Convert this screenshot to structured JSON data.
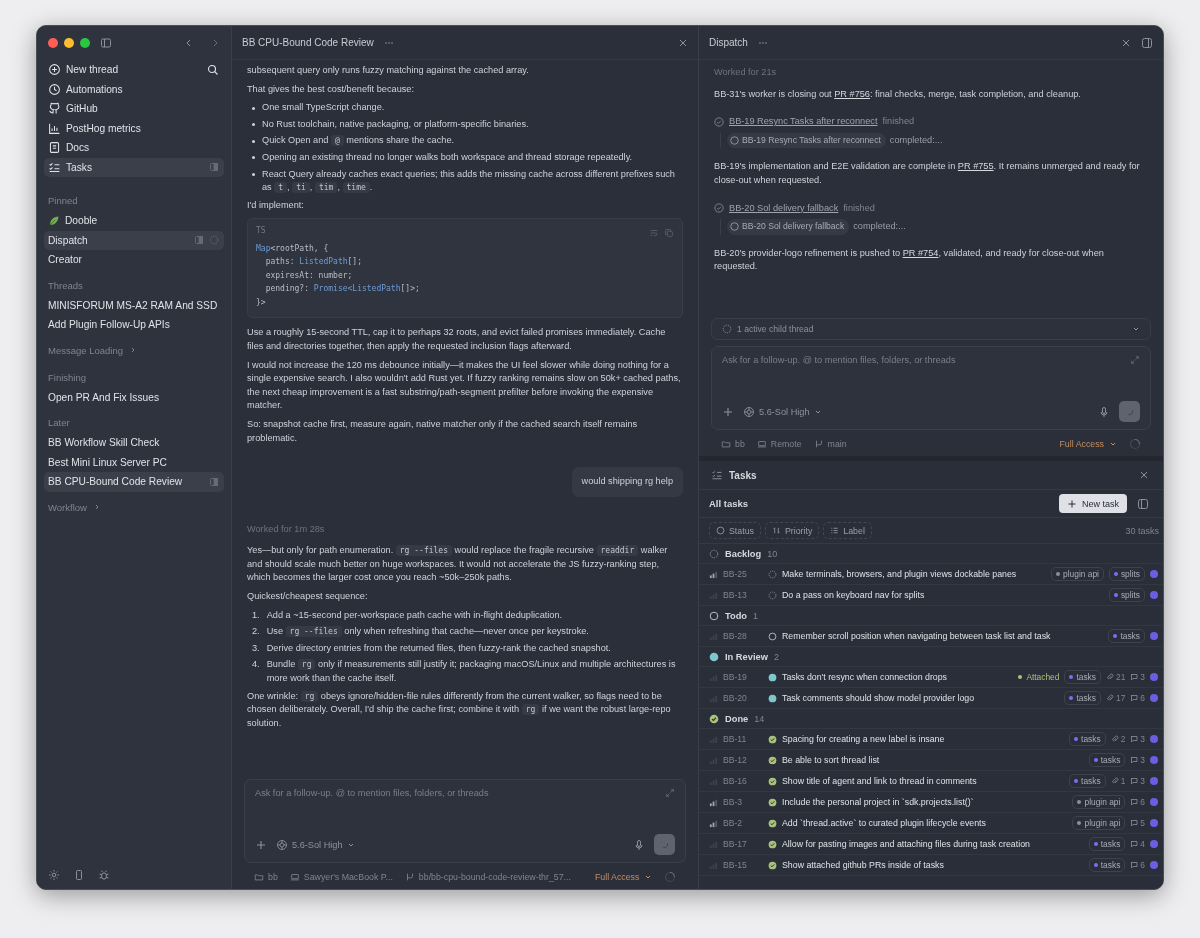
{
  "sidebar": {
    "nav": [
      {
        "label": "New thread",
        "selected": false
      },
      {
        "label": "Automations",
        "selected": false
      },
      {
        "label": "GitHub",
        "selected": false
      },
      {
        "label": "PostHog metrics",
        "selected": false
      },
      {
        "label": "Docs",
        "selected": false
      },
      {
        "label": "Tasks",
        "selected": true
      }
    ],
    "sections": [
      {
        "kind": "group",
        "title": "Pinned",
        "items": [
          {
            "kind": "project",
            "label": "Dooble",
            "selected": false,
            "running": false
          },
          {
            "kind": "thread",
            "label": "Dispatch",
            "selected": true,
            "running": true
          },
          {
            "kind": "thread",
            "label": "Creator",
            "selected": false,
            "running": false
          }
        ]
      },
      {
        "kind": "group",
        "title": "Threads",
        "items": [
          {
            "kind": "thread",
            "label": "MINISFORUM MS-A2 RAM And SSD",
            "selected": false,
            "running": false
          },
          {
            "kind": "thread",
            "label": "Add Plugin Follow-Up APIs",
            "selected": false,
            "running": false
          }
        ]
      },
      {
        "kind": "folder",
        "title": "Message Loading",
        "expanded": false
      },
      {
        "kind": "group",
        "title": "Finishing",
        "items": [
          {
            "kind": "thread",
            "label": "Open PR And Fix Issues",
            "selected": false,
            "running": false
          }
        ]
      },
      {
        "kind": "group",
        "title": "Later",
        "items": [
          {
            "kind": "thread",
            "label": "BB Workflow Skill Check",
            "selected": false,
            "running": false
          },
          {
            "kind": "thread",
            "label": "Best Mini Linux Server PC",
            "selected": false,
            "running": false
          },
          {
            "kind": "thread",
            "label": "BB CPU-Bound Code Review",
            "selected": true,
            "running": false
          }
        ]
      },
      {
        "kind": "folder",
        "title": "Workflow",
        "expanded": false
      }
    ]
  },
  "thread": {
    "title": "BB CPU-Bound Code Review",
    "blocks": [
      {
        "kind": "para",
        "parts": [
          {
            "kind": "text",
            "text": "subsequent query only runs fuzzy matching against the cached array."
          }
        ]
      },
      {
        "kind": "para",
        "parts": [
          {
            "kind": "text",
            "text": "That gives the best cost/benefit because:"
          }
        ]
      },
      {
        "kind": "bullets",
        "items": [
          [
            {
              "kind": "text",
              "text": "One small TypeScript change."
            }
          ],
          [
            {
              "kind": "text",
              "text": "No Rust toolchain, native packaging, or platform-specific binaries."
            }
          ],
          [
            {
              "kind": "text",
              "text": "Quick Open and "
            },
            {
              "kind": "code",
              "text": "@"
            },
            {
              "kind": "text",
              "text": " mentions share the cache."
            }
          ],
          [
            {
              "kind": "text",
              "text": "Opening an existing thread no longer walks both workspace and thread storage repeatedly."
            }
          ],
          [
            {
              "kind": "text",
              "text": "React Query already caches exact queries; this adds the missing cache across different prefixes such as "
            },
            {
              "kind": "code",
              "text": "t"
            },
            {
              "kind": "text",
              "text": ", "
            },
            {
              "kind": "code",
              "text": "ti"
            },
            {
              "kind": "text",
              "text": ", "
            },
            {
              "kind": "code",
              "text": "tim"
            },
            {
              "kind": "text",
              "text": ", "
            },
            {
              "kind": "code",
              "text": "time"
            },
            {
              "kind": "text",
              "text": "."
            }
          ]
        ]
      },
      {
        "kind": "para",
        "parts": [
          {
            "kind": "text",
            "text": "I'd implement:"
          }
        ]
      },
      {
        "kind": "code",
        "lang": "TS",
        "lines": [
          [
            {
              "kind": "type",
              "text": "Map"
            },
            {
              "kind": "plain",
              "text": "<rootPath, {"
            }
          ],
          [
            {
              "kind": "plain",
              "text": "  paths: "
            },
            {
              "kind": "type",
              "text": "ListedPath"
            },
            {
              "kind": "plain",
              "text": "[];"
            }
          ],
          [
            {
              "kind": "plain",
              "text": "  expiresAt: number;"
            }
          ],
          [
            {
              "kind": "plain",
              "text": "  pending?: "
            },
            {
              "kind": "type",
              "text": "Promise<ListedPath"
            },
            {
              "kind": "plain",
              "text": "[]>;"
            }
          ],
          [
            {
              "kind": "plain",
              "text": "}>"
            }
          ]
        ]
      },
      {
        "kind": "para",
        "parts": [
          {
            "kind": "text",
            "text": "Use a roughly 15-second TTL, cap it to perhaps 32 roots, and evict failed promises immediately. Cache files and directories together, then apply the requested inclusion flags afterward."
          }
        ]
      },
      {
        "kind": "para",
        "parts": [
          {
            "kind": "text",
            "text": "I would not increase the 120 ms debounce initially—it makes the UI feel slower while doing nothing for a single expensive search. I also wouldn't add Rust yet. If fuzzy ranking remains slow on 50k+ cached paths, the next cheap improvement is a fast substring/path-segment prefilter before invoking the expensive matcher."
          }
        ]
      },
      {
        "kind": "para",
        "parts": [
          {
            "kind": "text",
            "text": "So: snapshot cache first, measure again, native matcher only if the cached search itself remains problematic."
          }
        ]
      },
      {
        "kind": "user",
        "text": "would shipping rg help"
      },
      {
        "kind": "status",
        "text": "Worked for 1m 28s"
      },
      {
        "kind": "para",
        "parts": [
          {
            "kind": "text",
            "text": "Yes—but only for path enumeration. "
          },
          {
            "kind": "code",
            "text": "rg --files"
          },
          {
            "kind": "text",
            "text": " would replace the fragile recursive "
          },
          {
            "kind": "code",
            "text": "readdir"
          },
          {
            "kind": "text",
            "text": " walker and should scale much better on huge workspaces. It would not accelerate the JS fuzzy-ranking step, which becomes the larger cost once you reach ~50k–250k paths."
          }
        ]
      },
      {
        "kind": "para",
        "parts": [
          {
            "kind": "text",
            "text": "Quickest/cheapest sequence:"
          }
        ]
      },
      {
        "kind": "numbered",
        "items": [
          {
            "number": "1.",
            "parts": [
              {
                "kind": "text",
                "text": "Add a ~15-second per-workspace path cache with in-flight deduplication."
              }
            ]
          },
          {
            "number": "2.",
            "parts": [
              {
                "kind": "text",
                "text": "Use "
              },
              {
                "kind": "code",
                "text": "rg --files"
              },
              {
                "kind": "text",
                "text": " only when refreshing that cache—never once per keystroke."
              }
            ]
          },
          {
            "number": "3.",
            "parts": [
              {
                "kind": "text",
                "text": "Derive directory entries from the returned files, then fuzzy-rank the cached snapshot."
              }
            ]
          },
          {
            "number": "4.",
            "parts": [
              {
                "kind": "text",
                "text": "Bundle "
              },
              {
                "kind": "code",
                "text": "rg"
              },
              {
                "kind": "text",
                "text": " only if measurements still justify it; packaging macOS/Linux and multiple architectures is more work than the cache itself."
              }
            ]
          }
        ]
      },
      {
        "kind": "para",
        "parts": [
          {
            "kind": "text",
            "text": "One wrinkle: "
          },
          {
            "kind": "code",
            "text": "rg"
          },
          {
            "kind": "text",
            "text": " obeys ignore/hidden-file rules differently from the current walker, so flags need to be chosen deliberately. Overall, I'd ship the cache first; combine it with "
          },
          {
            "kind": "code",
            "text": "rg"
          },
          {
            "kind": "text",
            "text": " if we want the robust large-repo solution."
          }
        ]
      }
    ],
    "composer": {
      "placeholder": "Ask for a follow-up. @ to mention files, folders, or threads",
      "model": "5.6-Sol High"
    },
    "footer": {
      "items": [
        "bb",
        "Sawyer's MacBook P...",
        "bb/bb-cpu-bound-code-review-thr_57..."
      ],
      "access": "Full Access"
    }
  },
  "dispatch": {
    "title": "Dispatch",
    "blocks": [
      {
        "kind": "status",
        "text": "Worked for 21s"
      },
      {
        "kind": "para",
        "parts": [
          {
            "kind": "text",
            "text": "BB-31's worker is closing out "
          },
          {
            "kind": "link",
            "text": "PR #756"
          },
          {
            "kind": "text",
            "text": ": final checks, merge, task completion, and cleanup."
          }
        ]
      },
      {
        "kind": "event",
        "link": "BB-19 Resync Tasks after reconnect",
        "suffix": "finished",
        "chip": "BB-19 Resync Tasks after reconnect",
        "detail": "completed:..."
      },
      {
        "kind": "para",
        "parts": [
          {
            "kind": "text",
            "text": "BB-19's implementation and E2E validation are complete in "
          },
          {
            "kind": "link",
            "text": "PR #755"
          },
          {
            "kind": "text",
            "text": ". It remains unmerged and ready for close-out when requested."
          }
        ]
      },
      {
        "kind": "event",
        "link": "BB-20 Sol delivery fallback",
        "suffix": "finished",
        "chip": "BB-20 Sol delivery fallback",
        "detail": "completed:..."
      },
      {
        "kind": "para",
        "parts": [
          {
            "kind": "text",
            "text": "BB-20's provider-logo refinement is pushed to "
          },
          {
            "kind": "link",
            "text": "PR #754"
          },
          {
            "kind": "text",
            "text": ", validated, and ready for close-out when requested."
          }
        ]
      }
    ],
    "child_threads": {
      "text": "1 active child thread",
      "expanded": false
    },
    "composer": {
      "placeholder": "Ask for a follow-up. @ to mention files, folders, or threads",
      "model": "5.6-Sol High"
    },
    "footer": {
      "items": [
        "bb",
        "Remote",
        "main"
      ],
      "access": "Full Access"
    }
  },
  "tasks": {
    "title": "Tasks",
    "view": "All tasks",
    "new_button": "New task",
    "filters": [
      "Status",
      "Priority",
      "Label"
    ],
    "count": "30 tasks",
    "groups": [
      {
        "kind": "backlog",
        "name": "Backlog",
        "count": "10",
        "tasks": [
          {
            "id": "BB-25",
            "prioritized": true,
            "title": "Make terminals, browsers, and plugin views dockable panes",
            "labels": [
              {
                "text": "plugin api",
                "color": "#8a8f9b"
              },
              {
                "text": "splits",
                "color": "#7a6ff0"
              }
            ]
          },
          {
            "id": "BB-13",
            "prioritized": false,
            "title": "Do a pass on keyboard nav for splits",
            "labels": [
              {
                "text": "splits",
                "color": "#7a6ff0"
              }
            ]
          }
        ]
      },
      {
        "kind": "todo",
        "name": "Todo",
        "count": "1",
        "tasks": [
          {
            "id": "BB-28",
            "prioritized": false,
            "title": "Remember scroll position when navigating between task list and task",
            "labels": [
              {
                "text": "tasks",
                "color": "#7a6ff0"
              }
            ]
          }
        ]
      },
      {
        "kind": "review",
        "name": "In Review",
        "count": "2",
        "tasks": [
          {
            "id": "BB-19",
            "prioritized": false,
            "title": "Tasks don't resync when connection drops",
            "badge": "Attached",
            "labels": [
              {
                "text": "tasks",
                "color": "#7a6ff0"
              }
            ],
            "attachments": "21",
            "comments": "3"
          },
          {
            "id": "BB-20",
            "prioritized": false,
            "title": "Task comments should show model provider logo",
            "labels": [
              {
                "text": "tasks",
                "color": "#7a6ff0"
              }
            ],
            "attachments": "17",
            "comments": "6"
          }
        ]
      },
      {
        "kind": "done",
        "name": "Done",
        "count": "14",
        "tasks": [
          {
            "id": "BB-11",
            "prioritized": false,
            "title": "Spacing for creating a new label is insane",
            "labels": [
              {
                "text": "tasks",
                "color": "#7a6ff0"
              }
            ],
            "attachments": "2",
            "comments": "3"
          },
          {
            "id": "BB-12",
            "prioritized": false,
            "title": "Be able to sort thread list",
            "labels": [
              {
                "text": "tasks",
                "color": "#7a6ff0"
              }
            ],
            "comments": "3"
          },
          {
            "id": "BB-16",
            "prioritized": false,
            "title": "Show title of agent and link to thread in comments",
            "labels": [
              {
                "text": "tasks",
                "color": "#7a6ff0"
              }
            ],
            "attachments": "1",
            "comments": "3"
          },
          {
            "id": "BB-3",
            "prioritized": true,
            "title": "Include the personal project in `sdk.projects.list()`",
            "labels": [
              {
                "text": "plugin api",
                "color": "#8a8f9b"
              }
            ],
            "comments": "6"
          },
          {
            "id": "BB-2",
            "prioritized": true,
            "title": "Add `thread.active` to curated plugin lifecycle events",
            "labels": [
              {
                "text": "plugin api",
                "color": "#8a8f9b"
              }
            ],
            "comments": "5"
          },
          {
            "id": "BB-17",
            "prioritized": false,
            "title": "Allow for pasting images and attaching files during task creation",
            "labels": [
              {
                "text": "tasks",
                "color": "#7a6ff0"
              }
            ],
            "comments": "4"
          },
          {
            "id": "BB-15",
            "prioritized": false,
            "title": "Show attached github PRs inside of tasks",
            "labels": [
              {
                "text": "tasks",
                "color": "#7a6ff0"
              }
            ],
            "comments": "6"
          }
        ]
      }
    ]
  }
}
